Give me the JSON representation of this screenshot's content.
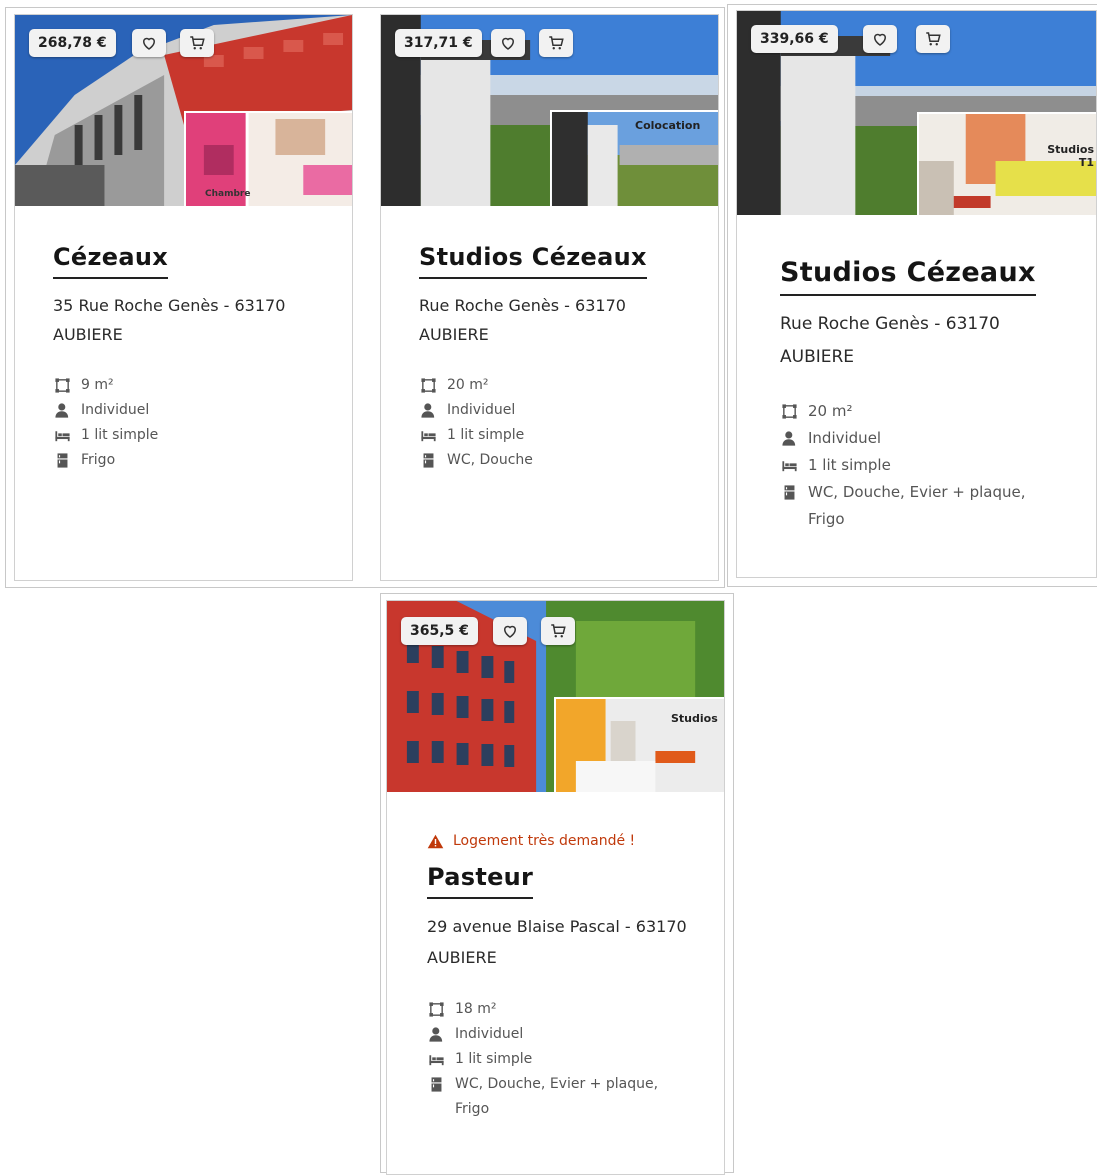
{
  "cards": [
    {
      "price": "268,78 €",
      "overlay_label": "Chambre",
      "title": "Cézeaux",
      "address_line1": "35 Rue Roche Genès - 63170",
      "address_line2": "AUBIERE",
      "features": {
        "area": "9 m²",
        "type": "Individuel",
        "bed": "1 lit simple",
        "equipment": "Frigo"
      }
    },
    {
      "price": "317,71 €",
      "overlay_label": "Colocation",
      "title": "Studios Cézeaux",
      "address_line1": "Rue Roche Genès - 63170",
      "address_line2": "AUBIERE",
      "features": {
        "area": "20 m²",
        "type": "Individuel",
        "bed": "1 lit simple",
        "equipment": "WC, Douche"
      }
    },
    {
      "price": "339,66 €",
      "overlay_label": "Studios T1",
      "title": "Studios Cézeaux",
      "address_line1": "Rue Roche Genès - 63170",
      "address_line2": "AUBIERE",
      "features": {
        "area": "20 m²",
        "type": "Individuel",
        "bed": "1 lit simple",
        "equipment": "WC, Douche, Evier + plaque, Frigo"
      }
    },
    {
      "price": "365,5 €",
      "overlay_label": "Studios",
      "warning": "Logement très demandé !",
      "title": "Pasteur",
      "address_line1": "29 avenue Blaise Pascal - 63170",
      "address_line2": "AUBIERE",
      "features": {
        "area": "18 m²",
        "type": "Individuel",
        "bed": "1 lit simple",
        "equipment": "WC, Douche, Evier + plaque, Frigo"
      }
    }
  ],
  "icons": {
    "favorite": "heart-icon",
    "cart": "cart-icon",
    "area": "area-icon",
    "type": "person-icon",
    "bed": "bed-icon",
    "equipment": "fridge-icon",
    "warning": "warning-icon"
  },
  "colors": {
    "warning": "#c0390b",
    "facade_red": "#c8372d",
    "room_pink": "#e0407a",
    "room_orange": "#f0a020"
  }
}
